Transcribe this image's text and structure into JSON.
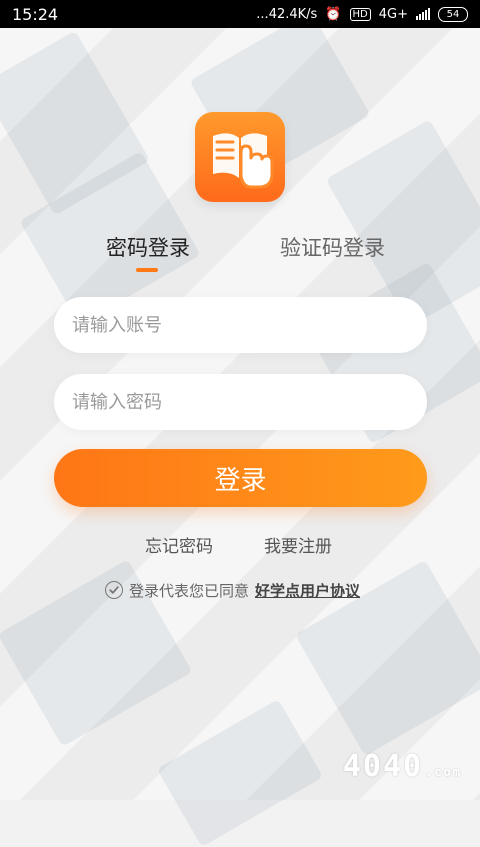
{
  "status_bar": {
    "time": "15:24",
    "network_speed": "...42.4K/s",
    "network_type": "4G+",
    "battery": "54"
  },
  "app": {
    "logo_icon": "book-hand-icon",
    "brand_color": "#ff7a17"
  },
  "tabs": {
    "items": [
      {
        "label": "密码登录",
        "active": true
      },
      {
        "label": "验证码登录",
        "active": false
      }
    ]
  },
  "form": {
    "account_placeholder": "请输入账号",
    "password_placeholder": "请输入密码",
    "submit_label": "登录"
  },
  "links": {
    "forgot_password": "忘记密码",
    "register": "我要注册"
  },
  "agreement": {
    "prefix": "登录代表您已同意",
    "link": "好学点用户协议"
  },
  "watermark": {
    "text": "4040",
    "suffix": ".com"
  }
}
